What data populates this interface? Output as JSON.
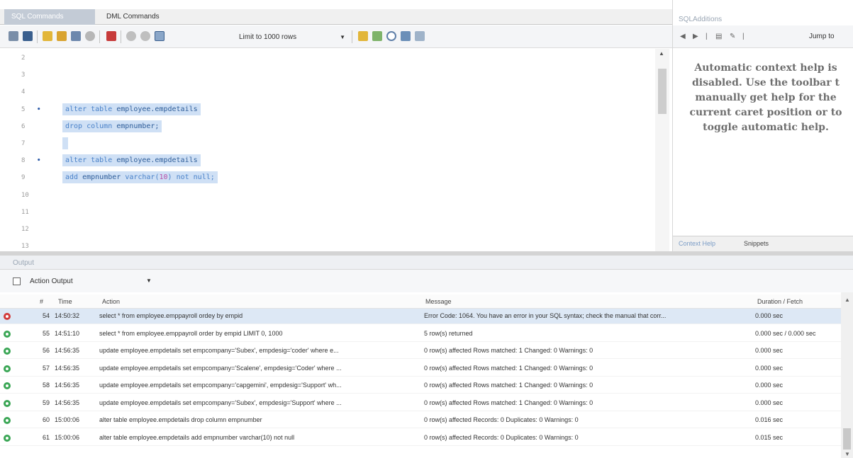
{
  "editor": {
    "tabs": [
      {
        "label": "SQL Commands",
        "active": true
      },
      {
        "label": "DML Commands",
        "active": false
      }
    ],
    "toolbar": {
      "limit_select": "Limit to 1000 rows",
      "icons": [
        "open-folder-icon",
        "save-icon",
        "execute-icon",
        "execute-current-icon",
        "explain-icon",
        "stop-icon",
        "toggle-error-icon",
        "commit-icon",
        "rollback-icon",
        "autocommit-icon",
        "beautify-icon",
        "find-icon",
        "invisible-chars-icon",
        "wrap-icon"
      ]
    },
    "lines": [
      {
        "num": "2",
        "marker": "",
        "text": ""
      },
      {
        "num": "3",
        "marker": "",
        "text": ""
      },
      {
        "num": "4",
        "marker": "",
        "text": ""
      },
      {
        "num": "5",
        "marker": "•",
        "kw": "alter table ",
        "id": "employee.empdetails",
        "rest": ""
      },
      {
        "num": "6",
        "marker": "",
        "kw": "drop column ",
        "id": "empnumber;",
        "rest": ""
      },
      {
        "num": "7",
        "marker": "",
        "text": ""
      },
      {
        "num": "8",
        "marker": "•",
        "kw": "alter table ",
        "id": "employee.empdetails",
        "rest": ""
      },
      {
        "num": "9",
        "marker": "",
        "kw": "add ",
        "id": "empnumber ",
        "type": "varchar(",
        "typenum": "10",
        "close": ")",
        "tail": " not null;"
      },
      {
        "num": "10",
        "marker": "",
        "text": ""
      },
      {
        "num": "11",
        "marker": "",
        "text": ""
      },
      {
        "num": "12",
        "marker": "",
        "text": ""
      },
      {
        "num": "13",
        "marker": "",
        "text": ""
      }
    ]
  },
  "side_panel": {
    "title": "SQLAdditions",
    "jump_to": "Jump to",
    "help_lines": [
      "Automatic context help is",
      "disabled. Use the toolbar t",
      "manually get help for the",
      "current caret position or to",
      "toggle automatic help."
    ],
    "tabs": [
      "Context Help",
      "Snippets"
    ]
  },
  "output": {
    "title": "Output",
    "selector": "Action Output",
    "columns": [
      "#",
      "Time",
      "Action",
      "Message",
      "Duration / Fetch"
    ],
    "rows": [
      {
        "status": "error",
        "no": "54",
        "time": "14:50:32",
        "action": "select * from employee.emppayroll ordey by empid",
        "message": "Error Code: 1064. You have an error in your SQL syntax; check the manual that corr...",
        "duration": "0.000 sec"
      },
      {
        "status": "ok",
        "no": "55",
        "time": "14:51:10",
        "action": "select * from employee.emppayroll order by empid LIMIT 0, 1000",
        "message": "5 row(s) returned",
        "duration": "0.000 sec / 0.000 sec"
      },
      {
        "status": "ok",
        "no": "56",
        "time": "14:56:35",
        "action": "update employee.empdetails set empcompany='Subex', empdesig='coder' where e...",
        "message": "0 row(s) affected Rows matched: 1  Changed: 0  Warnings: 0",
        "duration": "0.000 sec"
      },
      {
        "status": "ok",
        "no": "57",
        "time": "14:56:35",
        "action": "update employee.empdetails set empcompany='Scalene', empdesig='Coder' where ...",
        "message": "0 row(s) affected Rows matched: 1  Changed: 0  Warnings: 0",
        "duration": "0.000 sec"
      },
      {
        "status": "ok",
        "no": "58",
        "time": "14:56:35",
        "action": "update employee.empdetails set empcompany='capgemini', empdesig='Support' wh...",
        "message": "0 row(s) affected Rows matched: 1  Changed: 0  Warnings: 0",
        "duration": "0.000 sec"
      },
      {
        "status": "ok",
        "no": "59",
        "time": "14:56:35",
        "action": "update employee.empdetails set empcompany='Subex', empdesig='Support' where ...",
        "message": "0 row(s) affected Rows matched: 1  Changed: 0  Warnings: 0",
        "duration": "0.000 sec"
      },
      {
        "status": "ok",
        "no": "60",
        "time": "15:00:06",
        "action": "alter table employee.empdetails drop column empnumber",
        "message": "0 row(s) affected Records: 0  Duplicates: 0  Warnings: 0",
        "duration": "0.016 sec"
      },
      {
        "status": "ok",
        "no": "61",
        "time": "15:00:06",
        "action": "alter table employee.empdetails add empnumber varchar(10) not null",
        "message": "0 row(s) affected Records: 0  Duplicates: 0  Warnings: 0",
        "duration": "0.015 sec"
      }
    ]
  }
}
